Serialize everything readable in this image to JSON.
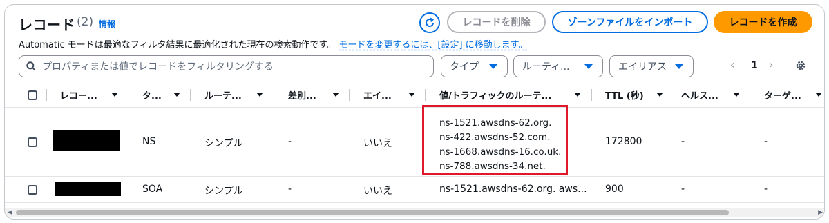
{
  "header": {
    "title": "レコード",
    "count": "(2)",
    "info_link": "情報",
    "description": "Automatic モードは最適なフィルタ結果に最適化された現在の検索動作です。",
    "description_link": "モードを変更するには、[設定] に移動します。"
  },
  "actions": {
    "delete_label": "レコードを削除",
    "import_label": "ゾーンファイルをインポート",
    "create_label": "レコードを作成"
  },
  "filters": {
    "search_placeholder": "プロパティまたは値でレコードをフィルタリングする",
    "type_label": "タイプ",
    "routing_label": "ルーティ...",
    "alias_label": "エイリアス"
  },
  "pagination": {
    "current_page": "1"
  },
  "table": {
    "columns": [
      "レコー...",
      "タ...",
      "ルーテ...",
      "差別...",
      "エイ...",
      "値/トラフィックのルーテ...",
      "TTL (秒)",
      "ヘルス...",
      "ターゲ..."
    ],
    "rows": [
      {
        "name": "",
        "type": "NS",
        "routing": "シンプル",
        "differentiator": "-",
        "alias": "いいえ",
        "values": [
          "ns-1521.awsdns-62.org.",
          "ns-422.awsdns-52.com.",
          "ns-1668.awsdns-16.co.uk.",
          "ns-788.awsdns-34.net."
        ],
        "ttl": "172800",
        "health": "-",
        "target": "-"
      },
      {
        "name": "",
        "type": "SOA",
        "routing": "シンプル",
        "differentiator": "-",
        "alias": "いいえ",
        "value": "ns-1521.awsdns-62.org. aws...",
        "ttl": "900",
        "health": "-",
        "target": "-"
      }
    ]
  },
  "colors": {
    "primary_button": "#ff9900",
    "link": "#006ce0",
    "highlight_border": "#e0192a"
  }
}
